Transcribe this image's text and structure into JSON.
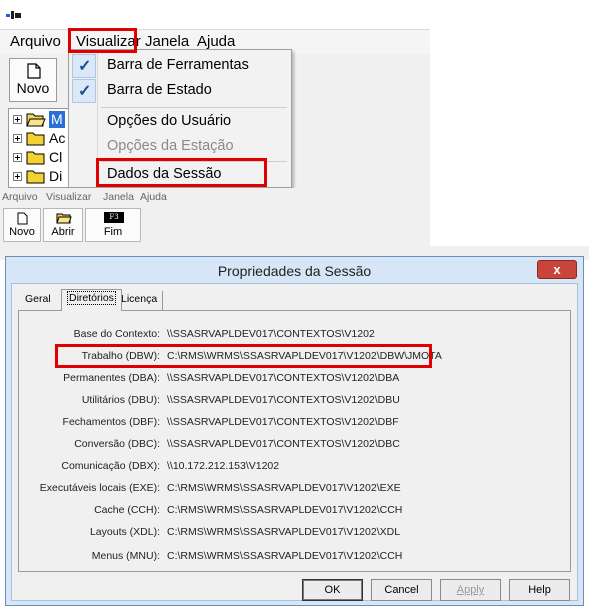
{
  "top": {
    "menu": [
      "Arquivo",
      "Visualizar",
      "Janela",
      "Ajuda"
    ],
    "toolbar": {
      "novo_label": "Novo"
    },
    "tree": [
      "M",
      "Ac",
      "Cl",
      "Di"
    ],
    "dropdown": {
      "barra_ferramentas": "Barra de Ferramentas",
      "barra_estado": "Barra de Estado",
      "opcoes_usuario": "Opções do Usuário",
      "opcoes_estacao": "Opções da Estação",
      "dados_sessao": "Dados da Sessão",
      "check_mark": "✓"
    }
  },
  "bottom": {
    "menu": [
      "Arquivo",
      "Visualizar",
      "Janela",
      "Ajuda"
    ],
    "toolbar": {
      "novo_label": "Novo",
      "abrir_label": "Abrir",
      "fim_label": "Fim",
      "fim_key": "F3"
    },
    "dialog": {
      "title": "Propriedades da Sessão",
      "close_symbol": "x",
      "tabs": [
        "Geral",
        "Diretórios",
        "Licença"
      ],
      "rows": [
        {
          "label": "Base do Contexto:",
          "value": "\\\\SSASRVAPLDEV017\\CONTEXTOS\\V1202"
        },
        {
          "label": "Trabalho (DBW):",
          "value": "C:\\RMS\\WRMS\\SSASRVAPLDEV017\\V1202\\DBW\\JMOTA"
        },
        {
          "label": "Permanentes (DBA):",
          "value": "\\\\SSASRVAPLDEV017\\CONTEXTOS\\V1202\\DBA"
        },
        {
          "label": "Utilitários (DBU):",
          "value": "\\\\SSASRVAPLDEV017\\CONTEXTOS\\V1202\\DBU"
        },
        {
          "label": "Fechamentos (DBF):",
          "value": "\\\\SSASRVAPLDEV017\\CONTEXTOS\\V1202\\DBF"
        },
        {
          "label": "Conversão (DBC):",
          "value": "\\\\SSASRVAPLDEV017\\CONTEXTOS\\V1202\\DBC"
        },
        {
          "label": "Comunicação (DBX):",
          "value": "\\\\10.172.212.153\\V1202"
        },
        {
          "label": "Executáveis locais (EXE):",
          "value": "C:\\RMS\\WRMS\\SSASRVAPLDEV017\\V1202\\EXE"
        },
        {
          "label": "Cache (CCH):",
          "value": "C:\\RMS\\WRMS\\SSASRVAPLDEV017\\V1202\\CCH"
        },
        {
          "label": "Layouts (XDL):",
          "value": "C:\\RMS\\WRMS\\SSASRVAPLDEV017\\V1202\\XDL"
        },
        {
          "label": "Menus (MNU):",
          "value": "C:\\RMS\\WRMS\\SSASRVAPLDEV017\\V1202\\CCH"
        }
      ],
      "buttons": {
        "ok": "OK",
        "cancel": "Cancel",
        "apply": "Apply",
        "help": "Help"
      }
    }
  },
  "colors": {
    "highlight": "#e10000",
    "dialog_frame": "#d6e6f7",
    "close_button": "#c7453a",
    "menu_check": "#1a4f9a"
  }
}
